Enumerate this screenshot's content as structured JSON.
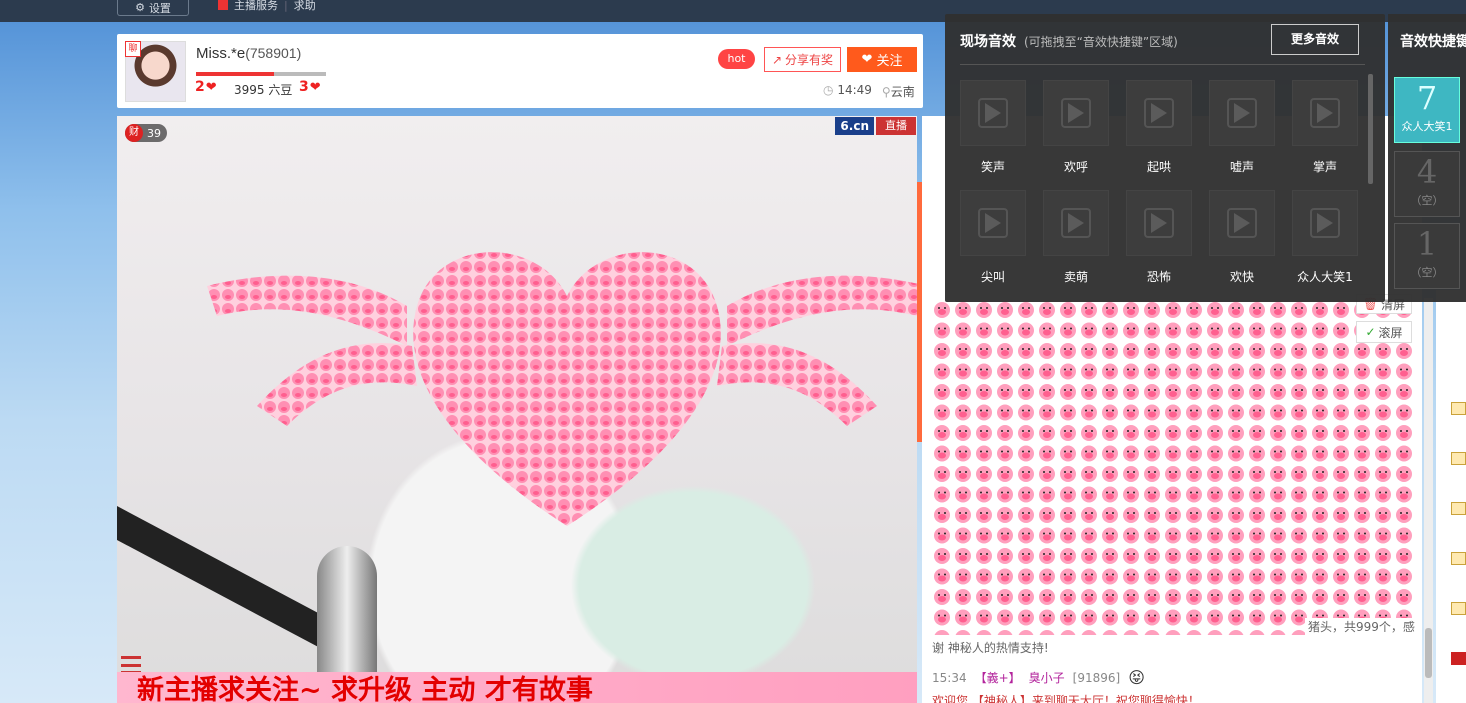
{
  "topbar": {
    "settings_label": "设置",
    "service_label": "主播服务",
    "help_label": "求助"
  },
  "anchor": {
    "name": "Miss.*e",
    "id": "(758901)",
    "level_badge": "聊",
    "level_progress": 0.6,
    "level_now": "2",
    "beans": "3995 六豆",
    "level_next": "3",
    "hot_label": "hot",
    "share_label": "分享有奖",
    "follow_label": "关注",
    "time": "14:49",
    "location": "云南"
  },
  "video": {
    "cai_icon": "财",
    "cai_count": "39",
    "brand": "6.cn",
    "live_label": "直播",
    "marquee": "新主播求关注~ 求升级  主动 才有故事"
  },
  "chat": {
    "gift_line": "谢 神秘人的热情支持!",
    "gift_tail": "猪头，共999个，感",
    "line2_time": "15:34",
    "line2_badge": "【義+】",
    "line2_user": "臭小子",
    "line2_uid": "[91896]",
    "line3": "欢迎您 【神秘人】来到聊天大厅！祝您聊得愉快！",
    "clear_label": "清屏",
    "scroll_label": "滚屏"
  },
  "sfx": {
    "title": "现场音效",
    "subtitle": "(可拖拽至“音效快捷键”区域)",
    "more_label": "更多音效",
    "items": [
      {
        "label": "笑声"
      },
      {
        "label": "欢呼"
      },
      {
        "label": "起哄"
      },
      {
        "label": "嘘声"
      },
      {
        "label": "掌声"
      },
      {
        "label": "尖叫"
      },
      {
        "label": "卖萌"
      },
      {
        "label": "恐怖"
      },
      {
        "label": "欢快"
      },
      {
        "label": "众人大笑1"
      }
    ]
  },
  "quick": {
    "title": "音效快捷键",
    "slots": [
      {
        "num": "7",
        "label": "众人大笑1",
        "active": true
      },
      {
        "num": "4",
        "label": "（空）",
        "active": false
      },
      {
        "num": "1",
        "label": "（空）",
        "active": false
      }
    ]
  },
  "colors": {
    "accent": "#ff5a1c",
    "brand_blue": "#1a3f8a",
    "live_red": "#cc3333",
    "sfx_active": "#3eb7c2"
  },
  "icons": [
    "gear-icon",
    "heart-icon",
    "share-icon",
    "location-icon",
    "clock-icon",
    "play-icon",
    "trash-icon",
    "check-icon",
    "menu-icon"
  ]
}
